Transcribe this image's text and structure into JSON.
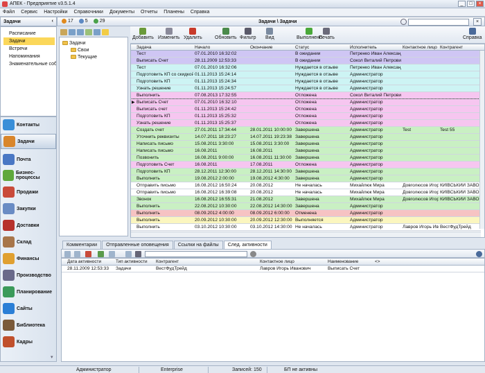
{
  "window": {
    "title": "АПЕК - Предприятие v3.5.1.4"
  },
  "menu": [
    "Файл",
    "Сервис",
    "Настройки",
    "Справочники",
    "Документы",
    "Отчеты",
    "Планены",
    "Справка"
  ],
  "left_panel": {
    "title": "Задачи",
    "items": [
      {
        "label": "Расписание",
        "selected": false
      },
      {
        "label": "Задачи",
        "selected": true
      },
      {
        "label": "Встречи",
        "selected": false
      },
      {
        "label": "Напоминания",
        "selected": false
      },
      {
        "label": "Знаменательные соб...",
        "selected": false
      }
    ]
  },
  "nav": [
    {
      "label": "Контакты",
      "color": "#3a8fd8",
      "active": false
    },
    {
      "label": "Задачи",
      "color": "#d9862b",
      "active": true
    },
    {
      "label": "Почта",
      "color": "#4a78c4",
      "active": false
    },
    {
      "label": "Бизнес-процессы",
      "color": "#5fa83c",
      "active": false
    },
    {
      "label": "Продажи",
      "color": "#c94a3a",
      "active": false
    },
    {
      "label": "Закупки",
      "color": "#6a8cc4",
      "active": false
    },
    {
      "label": "Доставки",
      "color": "#b7322c",
      "active": false
    },
    {
      "label": "Склад",
      "color": "#a8764a",
      "active": false
    },
    {
      "label": "Финансы",
      "color": "#e0a030",
      "active": false
    },
    {
      "label": "Производство",
      "color": "#6a6a8a",
      "active": false
    },
    {
      "label": "Планирование",
      "color": "#3b9a5a",
      "active": false
    },
    {
      "label": "Сайты",
      "color": "#2b7fd6",
      "active": false
    },
    {
      "label": "Библиотека",
      "color": "#7a5a3a",
      "active": false
    },
    {
      "label": "Кадры",
      "color": "#c0502c",
      "active": false
    }
  ],
  "header": {
    "title": "Задачи \\ Задачи",
    "counts": [
      {
        "value": "17",
        "color": "#e08a1e"
      },
      {
        "value": "5",
        "color": "#5d8ac4"
      },
      {
        "value": "29",
        "color": "#4aa14a"
      }
    ]
  },
  "tree": [
    {
      "label": "Задачи",
      "level": 0
    },
    {
      "label": "Свои",
      "level": 1
    },
    {
      "label": "Текущие",
      "level": 1
    }
  ],
  "toolbar": [
    {
      "label": "Добавить",
      "color": "#6a9a3a"
    },
    {
      "label": "Изменить",
      "color": "#8a8a9a"
    },
    {
      "label": "Удалить",
      "color": "#c83a2a"
    },
    {
      "label": "Обновить",
      "color": "#4a8a4a"
    },
    {
      "label": "Фильтр",
      "color": "#5a5a6a"
    },
    {
      "label": "Вид",
      "color": "#7a8aa0"
    },
    {
      "label": "Выполнено",
      "color": "#4aa83a"
    },
    {
      "label": "Печать",
      "color": "#6a6a7a"
    },
    {
      "label": "Справка",
      "color": "#4a6a9a"
    }
  ],
  "grid": {
    "columns": [
      "Задача",
      "Начало",
      "Окончание",
      "Статус",
      "Исполнитель",
      "Контактное лицо",
      "Контрагент"
    ],
    "rows": [
      {
        "cells": [
          "Тест",
          "07.01.2010 16:32:02",
          "",
          "В ожидании",
          "Петренко Иван Александ",
          "",
          ""
        ],
        "bg": "#cfc6f4"
      },
      {
        "cells": [
          "Выписать Счет",
          "28.11.2009 12:53:33",
          "",
          "В ожидании",
          "Сокол Виталий Петрович",
          "",
          ""
        ],
        "bg": "#cfc6f4"
      },
      {
        "cells": [
          "Тест",
          "07.01.2010 16:32:06",
          "",
          "Нуждается в отзыве",
          "Петренко Иван Александ",
          "",
          ""
        ],
        "bg": "#cdf4f4"
      },
      {
        "cells": [
          "Подготовить КП со скидкой",
          "01.11.2013 15:24:14",
          "",
          "Нуждается в отзыве",
          "Администратор",
          "",
          ""
        ],
        "bg": "#cdf4f4"
      },
      {
        "cells": [
          "Подготовить КП",
          "01.11.2013 15:24:34",
          "",
          "Нуждается в отзыве",
          "Администратор",
          "",
          ""
        ],
        "bg": "#cdf4f4"
      },
      {
        "cells": [
          "Узнать решение",
          "01.11.2013 15:24:57",
          "",
          "Нуждается в отзыве",
          "Администратор",
          "",
          ""
        ],
        "bg": "#cdf4f4"
      },
      {
        "cells": [
          "Выполнить",
          "07.08.2013 17:32:55",
          "",
          "Отложена",
          "Сокол Виталий Петрович",
          "",
          ""
        ],
        "bg": "#f6c6f0"
      },
      {
        "cells": [
          "Выписать Счет",
          "07.01.2010 16:32:10",
          "",
          "Отложена",
          "Администратор",
          "",
          ""
        ],
        "bg": "#f6c6f0",
        "current": true
      },
      {
        "cells": [
          "Выписать счет",
          "01.11.2013 15:24:42",
          "",
          "Отложена",
          "Администратор",
          "",
          ""
        ],
        "bg": "#f6c6f0"
      },
      {
        "cells": [
          "Подготовить КП",
          "01.11.2013 15:25:32",
          "",
          "Отложена",
          "Администратор",
          "",
          ""
        ],
        "bg": "#f6c6f0"
      },
      {
        "cells": [
          "Узнать решение",
          "01.11.2013 15:25:37",
          "",
          "Отложена",
          "Администратор",
          "",
          ""
        ],
        "bg": "#f6c6f0"
      },
      {
        "cells": [
          "Создать счет",
          "27.01.2011 17:34:44",
          "28.01.2011 10:00:00",
          "Завершена",
          "Администратор",
          "Test",
          "Test 55"
        ],
        "bg": "#c9f0c3"
      },
      {
        "cells": [
          "Уточнить реквизиты",
          "14.07.2011 18:23:27",
          "14.07.2011 19:23:38",
          "Завершена",
          "Администратор",
          "",
          ""
        ],
        "bg": "#c9f0c3"
      },
      {
        "cells": [
          "Написать письмо",
          "15.08.2011 3:30:00",
          "15.08.2011 3:30:00",
          "Завершена",
          "Администратор",
          "",
          ""
        ],
        "bg": "#c9f0c3"
      },
      {
        "cells": [
          "Написать письмо",
          "16.08.2011",
          "16.08.2011",
          "Завершена",
          "Администратор",
          "",
          ""
        ],
        "bg": "#c9f0c3"
      },
      {
        "cells": [
          "Позвонить",
          "16.08.2011 9:00:00",
          "16.08.2011 11:30:00",
          "Завершена",
          "Администратор",
          "",
          ""
        ],
        "bg": "#c9f0c3"
      },
      {
        "cells": [
          "Подготовить Счет",
          "16.08.2011",
          "17.08.2011",
          "Отложена",
          "Администратор",
          "",
          ""
        ],
        "bg": "#f6c6f0"
      },
      {
        "cells": [
          "Подготовить КП",
          "28.12.2011 12:30:00",
          "28.12.2011 14:30:00",
          "Завершена",
          "Администратор",
          "",
          ""
        ],
        "bg": "#c9f0c3"
      },
      {
        "cells": [
          "Выполнить",
          "19.08.2012 2:00:00",
          "19.08.2012 4:30:00",
          "Завершена",
          "Администратор",
          "",
          ""
        ],
        "bg": "#c9f0c3"
      },
      {
        "cells": [
          "Отправить письмо",
          "16.08.2012 16:50:24",
          "20.08.2012",
          "Не началась",
          "Михайлюк Мира",
          "Довголюсов Игор Б",
          "КИЇВСЬКИЙ ЗАВО"
        ],
        "bg": "#ffffff"
      },
      {
        "cells": [
          "Отправить письмо",
          "16.08.2012 16:39:08",
          "20.08.2012",
          "Не началась",
          "Михайлюк Мира",
          "Довголюсов Игор Б",
          "КИЇВСЬКИЙ ЗАВО"
        ],
        "bg": "#ffffff"
      },
      {
        "cells": [
          "Звонок",
          "16.08.2012 16:55:31",
          "21.08.2012",
          "Завершена",
          "Михайлюк Мира",
          "Довголюсов Игор Б",
          "КИЇВСЬКИЙ ЗАВО"
        ],
        "bg": "#c9f0c3"
      },
      {
        "cells": [
          "Выполнить",
          "22.08.2012 10:30:00",
          "22.08.2012 14:30:00",
          "Завершена",
          "Администратор",
          "",
          ""
        ],
        "bg": "#c9f0c3"
      },
      {
        "cells": [
          "Выполнить",
          "08.09.2012 4:00:00",
          "08.09.2012 6:00:00",
          "Отменена",
          "Администратор",
          "",
          ""
        ],
        "bg": "#f6c3c3"
      },
      {
        "cells": [
          "Выполнить",
          "20.09.2012 10:30:00",
          "20.09.2012 12:30:00",
          "Выполняется",
          "Администратор",
          "",
          ""
        ],
        "bg": "#fbf6bf"
      },
      {
        "cells": [
          "Выполнить",
          "03.10.2012 10:30:00",
          "03.10.2012 14:30:00",
          "Не началась",
          "Администратор",
          "Лавров Игорь Иван",
          "ВестФудТрейд"
        ],
        "bg": "#ffffff"
      }
    ]
  },
  "bottom_tabs": [
    {
      "label": "Комментарии",
      "active": false
    },
    {
      "label": "Отправленные оповещения",
      "active": false
    },
    {
      "label": "Ссылки на файлы",
      "active": false
    },
    {
      "label": "След. активности",
      "active": true
    }
  ],
  "subgrid": {
    "columns": [
      "Дата активности",
      "Тип активности",
      "Контрагент",
      "Контактное лицо",
      "Наименование",
      "<>"
    ],
    "rows": [
      [
        "28.11.2009 12:53:33",
        "Задачи",
        "ВестФудТрейд",
        "Лавров Игорь Иванович",
        "Выписать Счет"
      ]
    ]
  },
  "status": [
    "Администратор",
    "Enterprise",
    "Записей: 150",
    "БП не активны"
  ]
}
